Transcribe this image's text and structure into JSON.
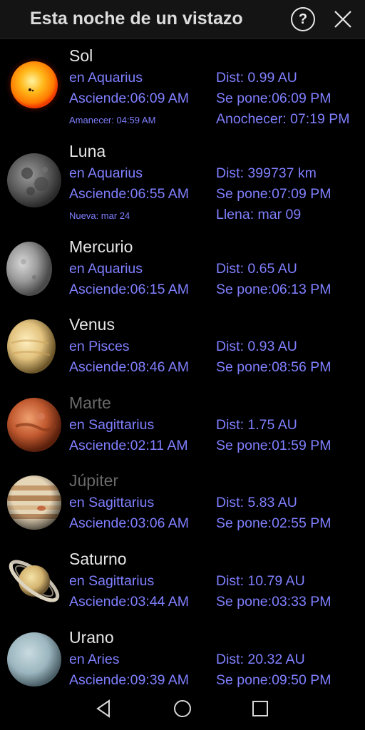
{
  "header": {
    "title": "Esta noche de un vistazo",
    "help_icon": "question-circle-icon",
    "close_icon": "close-icon"
  },
  "objects": [
    {
      "key": "sol",
      "name": "Sol",
      "constellation": "en Aquarius",
      "distance": "Dist: 0.99 AU",
      "rise": "Asciende:06:09 AM",
      "set": "Se pone:06:09 PM",
      "extra_left": "Amanecer: 04:59 AM",
      "extra_right": "Anochecer: 07:19 PM"
    },
    {
      "key": "luna",
      "name": "Luna",
      "constellation": "en Aquarius",
      "distance": "Dist: 399737 km",
      "rise": "Asciende:06:55 AM",
      "set": "Se pone:07:09 PM",
      "extra_left": "Nueva: mar 24",
      "extra_right": "Llena: mar 09"
    },
    {
      "key": "mercurio",
      "name": "Mercurio",
      "constellation": "en Aquarius",
      "distance": "Dist: 0.65 AU",
      "rise": "Asciende:06:15 AM",
      "set": "Se pone:06:13 PM"
    },
    {
      "key": "venus",
      "name": "Venus",
      "constellation": "en Pisces",
      "distance": "Dist: 0.93 AU",
      "rise": "Asciende:08:46 AM",
      "set": "Se pone:08:56 PM"
    },
    {
      "key": "marte",
      "name": "Marte",
      "constellation": "en Sagittarius",
      "distance": "Dist: 1.75 AU",
      "rise": "Asciende:02:11 AM",
      "set": "Se pone:01:59 PM"
    },
    {
      "key": "jupiter",
      "name": "Júpiter",
      "constellation": "en Sagittarius",
      "distance": "Dist: 5.83 AU",
      "rise": "Asciende:03:06 AM",
      "set": "Se pone:02:55 PM"
    },
    {
      "key": "saturno",
      "name": "Saturno",
      "constellation": "en Sagittarius",
      "distance": "Dist: 10.79 AU",
      "rise": "Asciende:03:44 AM",
      "set": "Se pone:03:33 PM"
    },
    {
      "key": "urano",
      "name": "Urano",
      "constellation": "en Aries",
      "distance": "Dist: 20.32 AU",
      "rise": "Asciende:09:39 AM",
      "set": "Se pone:09:50 PM"
    }
  ],
  "navbar": {
    "back_icon": "back-triangle-icon",
    "home_icon": "home-circle-icon",
    "recents_icon": "recents-square-icon"
  },
  "colors": {
    "background": "#000000",
    "header_bg": "#141414",
    "info_text": "#7f7fff",
    "name_text": "#e6e6e6",
    "dim_name_text": "#6a6a6a"
  }
}
